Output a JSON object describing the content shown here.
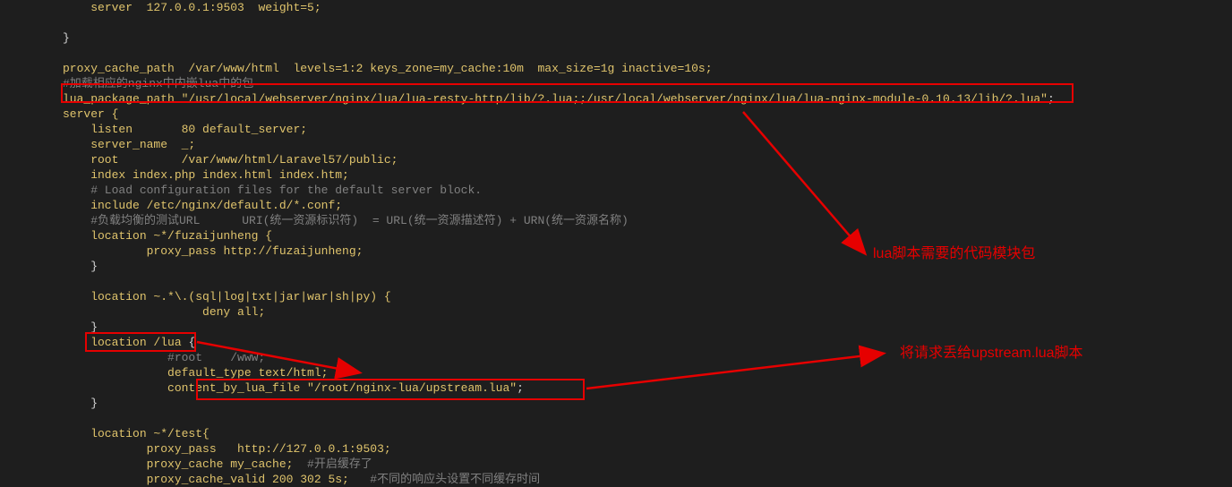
{
  "code": {
    "l01": "server  127.0.0.1:9503  weight=5;",
    "l02": "",
    "l03": "}",
    "l04": "",
    "l05_a": "proxy_cache_path",
    "l05_b": "  /var/www/html  levels=1:2 keys_zone=my_cache:10m  max_size=1g inactive=10s;",
    "l06": "#加载相应的nginx中内嵌lua中的包",
    "l07_a": "lua_package_path ",
    "l07_b": "\"/usr/local/webserver/nginx/lua/lua-resty-http/lib/?.lua;;/usr/local/webserver/nginx/lua/lua-nginx-module-0.10.13/lib/?.lua\"",
    "l07_c": ";",
    "l08": "server {",
    "l09_a": "    listen       ",
    "l09_b": "80 default_server;",
    "l10_a": "    server_name  ",
    "l10_b": "_;",
    "l11_a": "    root         ",
    "l11_b": "/var/www/html/Laravel57/public;",
    "l12_a": "    index ",
    "l12_b": "index.php index.html index.htm;",
    "l13": "    # Load configuration files for the default server block.",
    "l14_a": "    include ",
    "l14_b": "/etc/nginx/default.d/*.conf;",
    "l15": "    #负载均衡的测试URL      URI(统一资源标识符)  = URL(统一资源描述符) + URN(统一资源名称)",
    "l16_a": "    location ",
    "l16_b": "~*/fuzaijunheng {",
    "l17_a": "            proxy_pass ",
    "l17_b": "http://fuzaijunheng;",
    "l18": "    }",
    "l19": "",
    "l20_a": "    location ",
    "l20_b": "~.*\\.(sql|log|txt|jar|war|sh|py) {",
    "l21_a": "                    deny ",
    "l21_b": "all;",
    "l22": "    }",
    "l23_a": "    location ",
    "l23_b": "/lua",
    "l23_c": " {",
    "l24": "               #root    /www;",
    "l25_a": "               default_type ",
    "l25_b": "text/html;",
    "l26_a": "               content_by_lua_file ",
    "l26_b": "\"/root/nginx-lua/upstream.lua\"",
    "l26_c": ";",
    "l27": "    }",
    "l28": "",
    "l29_a": "    location ",
    "l29_b": "~*/test{",
    "l30_a": "            proxy_pass   ",
    "l30_b": "http://127.0.0.1:9503;",
    "l31_a": "            proxy_cache ",
    "l31_b": "my_cache;",
    "l31_c": "  #开启缓存了",
    "l32_a": "            proxy_cache_valid ",
    "l32_b": "200 302 5s;",
    "l32_c": "   #不同的响应头设置不同缓存时间"
  },
  "annotations": {
    "anno1": "lua脚本需要的代码模块包",
    "anno2": "将请求丢给upstream.lua脚本"
  }
}
